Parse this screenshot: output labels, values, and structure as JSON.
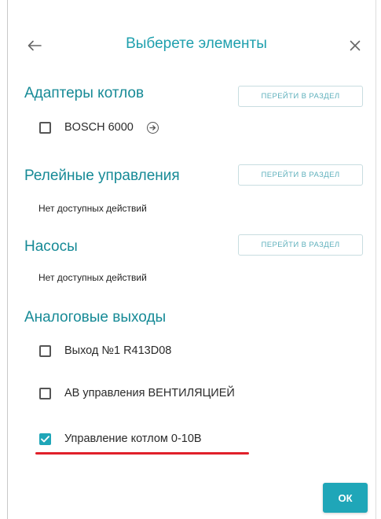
{
  "header": {
    "title": "Выберете элементы",
    "back_icon": "arrow-left-icon",
    "close_icon": "close-icon"
  },
  "sections": [
    {
      "title": "Адаптеры котлов",
      "goto_label": "ПЕРЕЙТИ В РАЗДЕЛ",
      "items": [
        {
          "label": "BOSCH 6000",
          "checked": false,
          "icon": "arrow-right-circle-icon"
        }
      ]
    },
    {
      "title": "Релейные управления",
      "goto_label": "ПЕРЕЙТИ В РАЗДЕЛ",
      "empty_text": "Нет доступных действий"
    },
    {
      "title": "Насосы",
      "goto_label": "ПЕРЕЙТИ В РАЗДЕЛ",
      "empty_text": "Нет доступных действий"
    },
    {
      "title": "Аналоговые выходы",
      "items": [
        {
          "label": "Выход №1 R413D08",
          "checked": false
        },
        {
          "label": "АВ управления ВЕНТИЛЯЦИЕЙ",
          "checked": false
        },
        {
          "label": "Управление котлом 0-10В",
          "checked": true
        }
      ]
    }
  ],
  "footer": {
    "ok_label": "ОК"
  },
  "colors": {
    "accent": "#1fa6b8",
    "section_title": "#168a96",
    "highlight_underline": "#e0202a"
  }
}
